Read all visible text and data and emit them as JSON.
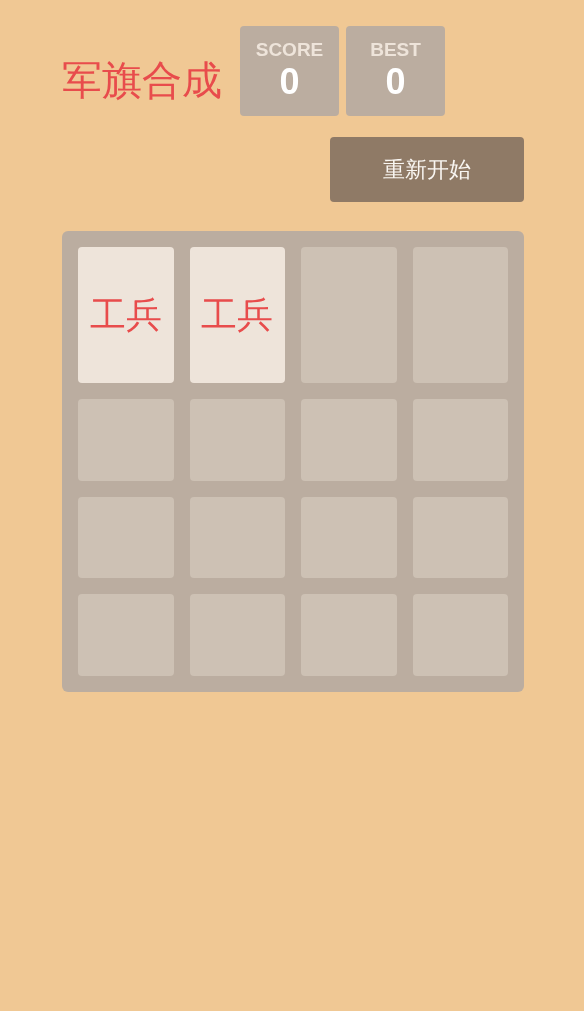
{
  "title": "军旗合成",
  "scores": [
    {
      "label": "SCORE",
      "value": "0"
    },
    {
      "label": "BEST",
      "value": "0"
    }
  ],
  "restart_button": "重新开始",
  "board": [
    {
      "kind": "tile",
      "label": "工兵"
    },
    {
      "kind": "tile",
      "label": "工兵"
    },
    {
      "kind": "empty"
    },
    {
      "kind": "empty"
    },
    {
      "kind": "empty"
    },
    {
      "kind": "empty"
    },
    {
      "kind": "empty"
    },
    {
      "kind": "empty"
    },
    {
      "kind": "empty"
    },
    {
      "kind": "empty"
    },
    {
      "kind": "empty"
    },
    {
      "kind": "empty"
    },
    {
      "kind": "empty"
    },
    {
      "kind": "empty"
    },
    {
      "kind": "empty"
    },
    {
      "kind": "empty"
    }
  ]
}
